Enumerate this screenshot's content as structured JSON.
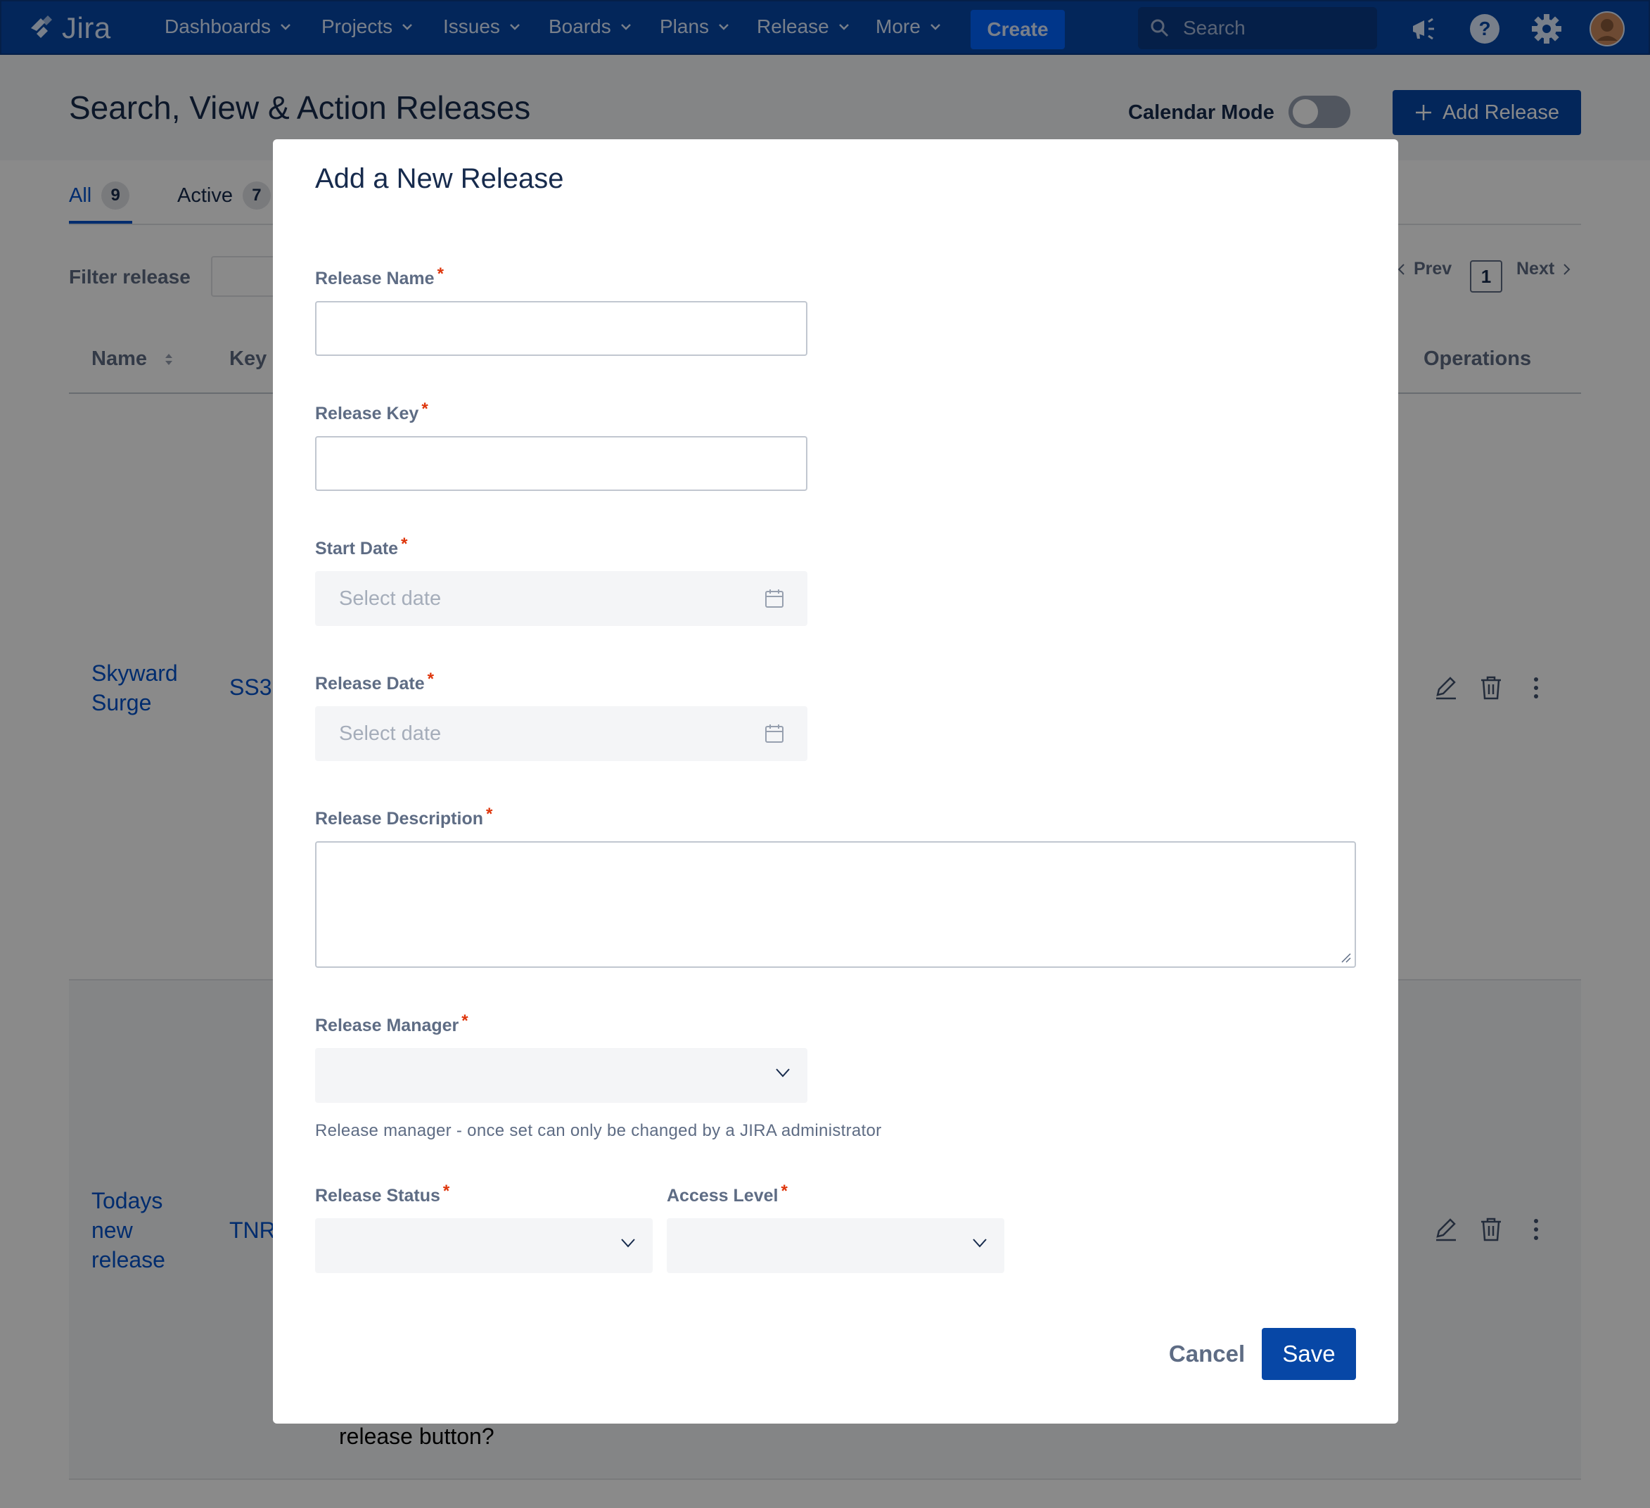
{
  "nav": {
    "logo_text": "Jira",
    "items": [
      {
        "label": "Dashboards"
      },
      {
        "label": "Projects"
      },
      {
        "label": "Issues"
      },
      {
        "label": "Boards"
      },
      {
        "label": "Plans"
      },
      {
        "label": "Release"
      },
      {
        "label": "More"
      }
    ],
    "create_label": "Create",
    "search_placeholder": "Search",
    "icons": [
      "megaphone-icon",
      "help-icon",
      "settings-gear-icon",
      "user-avatar"
    ]
  },
  "page": {
    "title": "Search, View & Action Releases",
    "calendar_mode_label": "Calendar Mode",
    "calendar_mode_on": false,
    "add_release_label": "Add Release",
    "tabs": [
      {
        "label": "All",
        "count": "9",
        "active": true
      },
      {
        "label": "Active",
        "count": "7",
        "active": false
      }
    ],
    "filter_label": "Filter release",
    "pagination": {
      "prev": "Prev",
      "current": "1",
      "next": "Next"
    },
    "columns": {
      "name": "Name",
      "key": "Key",
      "operations": "Operations"
    },
    "rows": [
      {
        "name_line1": "Skyward",
        "name_line2": "Surge",
        "key": "SS3"
      },
      {
        "name_line1": "Todays",
        "name_line2": "new",
        "name_line3": "release",
        "key": "TNR"
      }
    ],
    "peek_text": "release button?"
  },
  "modal": {
    "title": "Add a New Release",
    "required_mark": "*",
    "fields": {
      "release_name": {
        "label": "Release Name",
        "value": ""
      },
      "release_key": {
        "label": "Release Key",
        "value": ""
      },
      "start_date": {
        "label": "Start Date",
        "placeholder": "Select date"
      },
      "release_date": {
        "label": "Release Date",
        "placeholder": "Select date"
      },
      "release_description": {
        "label": "Release Description",
        "value": ""
      },
      "release_manager": {
        "label": "Release Manager",
        "helper": "Release manager - once set can only be changed by a JIRA administrator"
      },
      "release_status": {
        "label": "Release Status"
      },
      "access_level": {
        "label": "Access Level"
      }
    },
    "cancel_label": "Cancel",
    "save_label": "Save"
  },
  "colors": {
    "nav_bg": "#0747a6",
    "primary": "#0747a6",
    "link": "#0052cc",
    "required": "#de350b",
    "label": "#5e6c84"
  }
}
